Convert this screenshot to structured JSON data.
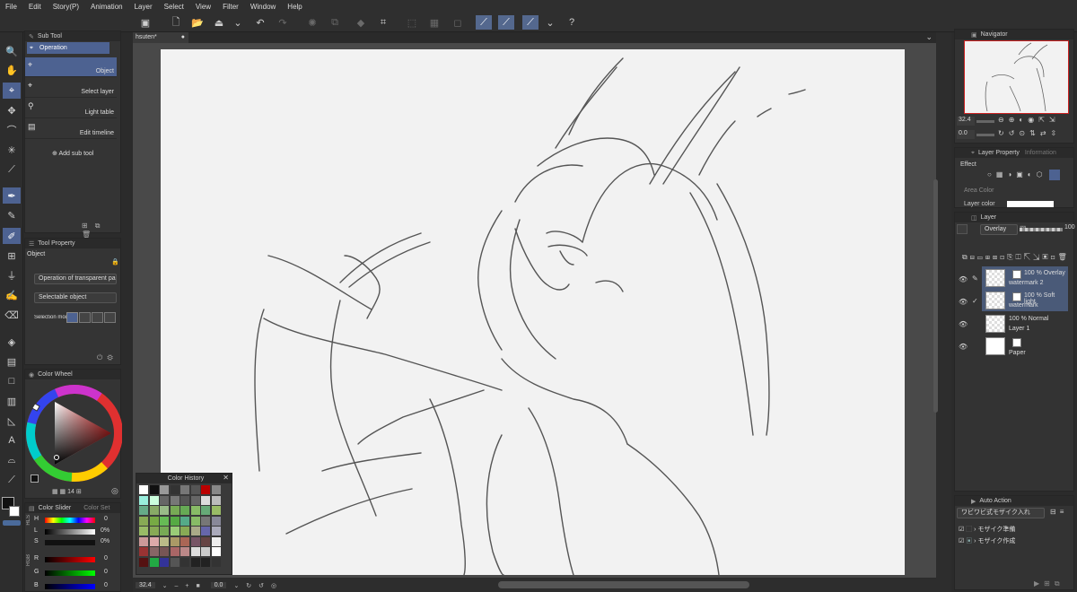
{
  "menu": [
    "File",
    "Edit",
    "Story(P)",
    "Animation",
    "Layer",
    "Select",
    "View",
    "Filter",
    "Window",
    "Help"
  ],
  "sub_tool": {
    "tab": "Sub Tool",
    "group": "Operation",
    "items": [
      "Object",
      "Select layer",
      "Light table",
      "Edit timeline"
    ],
    "add": "Add sub tool"
  },
  "tool_property": {
    "tab": "Tool Property",
    "title": "Object",
    "dropdown1": "Operation of transparent part",
    "dropdown2": "Selectable object",
    "selection_mode": "Selection mode"
  },
  "color_wheel": {
    "tab": "Color Wheel",
    "value": "14"
  },
  "color_history": {
    "title": "Color History"
  },
  "color_slider": {
    "tab": "Color Slider",
    "tab2": "Color Set",
    "labels": [
      "H",
      "L",
      "S",
      "R",
      "G",
      "B"
    ],
    "values": [
      "0",
      "0%",
      "0%",
      "0",
      "0",
      "0"
    ],
    "group1": "HLS",
    "group2": "RGB"
  },
  "document_tab": "hsuten*",
  "navigator": {
    "tab": "Navigator",
    "zoom": "32.4",
    "angle": "0.0"
  },
  "layer_property": {
    "tab": "Layer Property",
    "tab2": "Information",
    "effect": "Effect",
    "area_color": "Area Color",
    "layer_color": "Layer color"
  },
  "layer_panel": {
    "tab": "Layer",
    "blend": "Overlay",
    "opacity": "100",
    "layers": [
      {
        "mode": "100 % Overlay",
        "name": "watermark 2"
      },
      {
        "mode": "100 % Soft light",
        "name": "watermark"
      },
      {
        "mode": "100 % Normal",
        "name": "Layer 1"
      },
      {
        "mode": "",
        "name": "Paper"
      }
    ]
  },
  "auto_action": {
    "tab": "Auto Action",
    "set": "ワビワビ式モザイク入れ",
    "items": [
      "モザイク準備",
      "モザイク作成"
    ]
  },
  "status": {
    "zoom": "32.4",
    "angle": "0.0"
  },
  "colors": {
    "accent": "#54688e",
    "selected": "#4d6291"
  }
}
